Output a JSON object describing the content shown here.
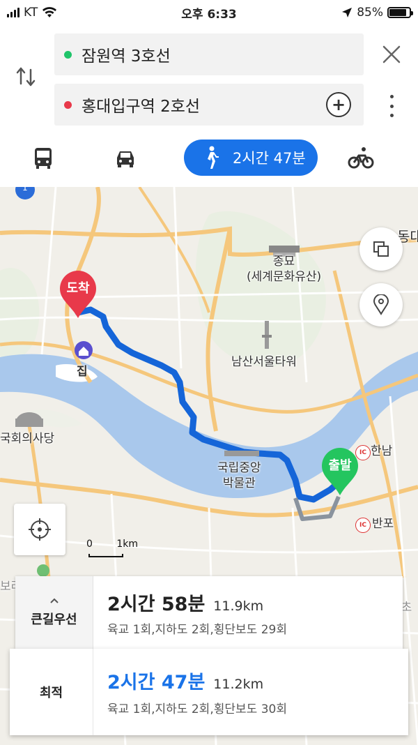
{
  "status": {
    "carrier": "KT",
    "time": "오후 6:33",
    "battery": "85%"
  },
  "route": {
    "origin": "잠원역 3호선",
    "destination": "홍대입구역 2호선",
    "origin_dot_color": "#1fc46a",
    "destination_dot_color": "#e8394a"
  },
  "modes": {
    "items": [
      "bus-icon",
      "car-icon",
      "walk-icon",
      "bike-icon"
    ],
    "active": "walk",
    "walk_time": "2시간 47분",
    "active_color": "#1a73e8"
  },
  "map": {
    "labels": {
      "jongmyo": "종묘",
      "jongmyo_sub": "(세계문화유산)",
      "namsan": "남산서울타워",
      "home": "집",
      "assembly": "국회의사당",
      "museum_line1": "국립중앙",
      "museum_line2": "박물관",
      "hannam": "한남",
      "banpo": "반포",
      "east_edge": "동대",
      "park_partial": "보라매공원",
      "seocho_partial": "서초"
    },
    "pins": {
      "destination": "도착",
      "origin": "출발"
    },
    "ic": "IC",
    "badge": "1",
    "scale": {
      "zero": "0",
      "unit": "1km"
    },
    "route_color": "#1565d8"
  },
  "options": [
    {
      "label": "큰길우선",
      "duration": "2시간 58분",
      "distance": "11.9km",
      "details": "육교 1회,지하도 2회,횡단보도 29회",
      "selected": false
    },
    {
      "label": "최적",
      "duration": "2시간 47분",
      "distance": "11.2km",
      "details": "육교 1회,지하도 2회,횡단보도 30회",
      "selected": true,
      "highlight_color": "#1a73e8"
    }
  ]
}
